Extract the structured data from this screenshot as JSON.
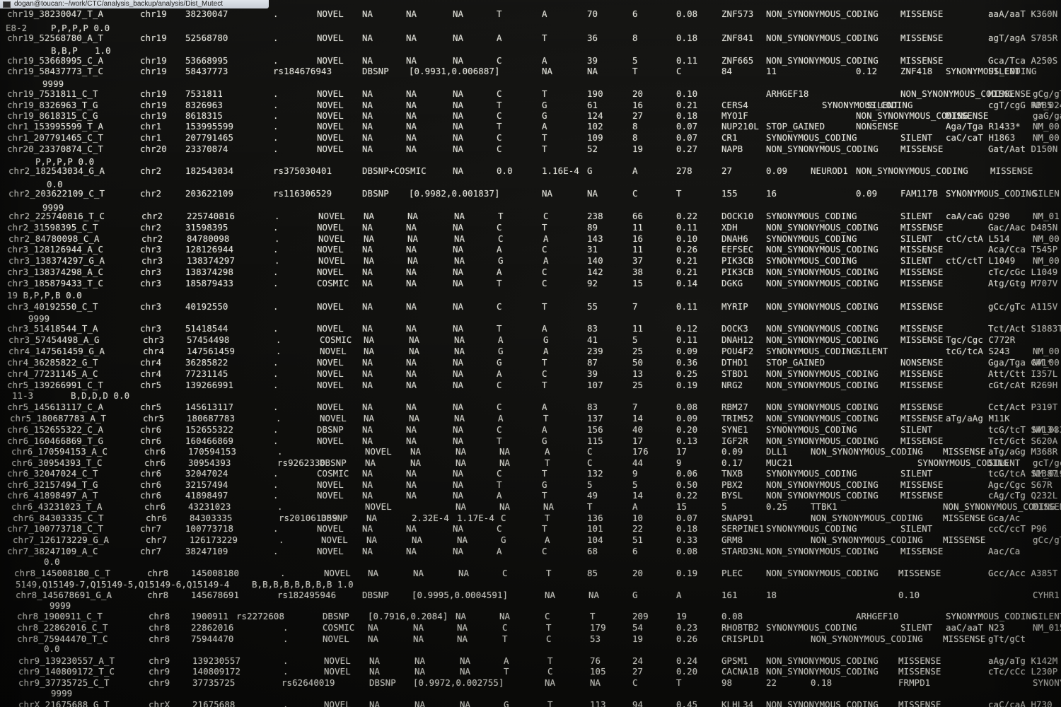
{
  "window": {
    "title": "dogan@toucan:~/work/CTC/analysis_backup/analysis/Dist_Mutect"
  },
  "rows": [
    [
      "chr19_38230047_T_A",
      "chr19",
      "38230047",
      ".",
      "NOVEL",
      "NA",
      "NA",
      "NA",
      "T",
      "A",
      "70",
      "6",
      "0.08",
      "ZNF573",
      "NON_SYNONYMOUS_CODING",
      "MISSENSE",
      "aaA/aaT K360N"
    ],
    [
      "E8-2",
      "P,P,P,P 0.0"
    ],
    [
      "chr19_52568780_A_T",
      "chr19",
      "52568780",
      ".",
      "NOVEL",
      "NA",
      "NA",
      "NA",
      "A",
      "T",
      "36",
      "8",
      "0.18",
      "ZNF841",
      "NON_SYNONYMOUS_CODING",
      "MISSENSE",
      "agT/agA S785R"
    ],
    [
      "B,B,P",
      "1.0"
    ],
    [
      "chr19_53668995_C_A",
      "chr19",
      "53668995",
      ".",
      "NOVEL",
      "NA",
      "NA",
      "NA",
      "C",
      "A",
      "39",
      "5",
      "0.11",
      "ZNF665",
      "NON_SYNONYMOUS_CODING",
      "MISSENSE",
      "Gca/Tca A250S"
    ],
    [
      "chr19_58437773_T_C",
      "chr19",
      "58437773",
      "rs184676943",
      "DBSNP",
      "[0.9931,0.006887]",
      "NA",
      "NA",
      "T",
      "C",
      "84",
      "11",
      "0.12",
      "ZNF418",
      "SYNONYMOUS_CODING",
      "SILENT"
    ],
    [
      "9999"
    ],
    [
      "chr19_7531811_C_T",
      "chr19",
      "7531811",
      ".",
      "NOVEL",
      "NA",
      "NA",
      "NA",
      "C",
      "T",
      "190",
      "20",
      "0.10",
      "ARHGEF18",
      "NON_SYNONYMOUS_CODING",
      "MISSENSE",
      "gCg/gTg A625V"
    ],
    [
      "chr19_8326963_T_G",
      "chr19",
      "8326963",
      ".",
      "NOVEL",
      "NA",
      "NA",
      "NA",
      "T",
      "G",
      "61",
      "16",
      "0.21",
      "CERS4",
      "SYNONYMOUS_CODING",
      "SILENT",
      "cgT/cgG R385",
      "NM_024552.2"
    ],
    [
      "chr19_8618315_C_G",
      "chr19",
      "8618315",
      ".",
      "NOVEL",
      "NA",
      "NA",
      "NA",
      "C",
      "G",
      "124",
      "27",
      "0.18",
      "MYO1F",
      "NON_SYNONYMOUS_CODING",
      "MISSENSE",
      "gaG/gaC E111D",
      "NM_01"
    ],
    [
      "chr1_153995599_T_A",
      "chr1",
      "153995599",
      ".",
      "NOVEL",
      "NA",
      "NA",
      "NA",
      "T",
      "A",
      "102",
      "8",
      "0.07",
      "NUP210L",
      "STOP_GAINED",
      "NONSENSE",
      "Aga/Tga R1433*",
      "NM_00"
    ],
    [
      "chr1_207791465_C_T",
      "chr1",
      "207791465",
      ".",
      "NOVEL",
      "NA",
      "NA",
      "NA",
      "C",
      "T",
      "109",
      "8",
      "0.07",
      "CR1",
      "SYNONYMOUS_CODING",
      "SILENT",
      "caC/caT H1863",
      "NM_00"
    ],
    [
      "chr20_23370874_C_T",
      "chr20",
      "23370874",
      ".",
      "NOVEL",
      "NA",
      "NA",
      "NA",
      "C",
      "T",
      "52",
      "19",
      "0.27",
      "NAPB",
      "NON_SYNONYMOUS_CODING",
      "MISSENSE",
      "Gat/Aat D150N"
    ],
    [
      "P,P,P,P 0.0"
    ],
    [
      "chr2_182543034_G_A",
      "chr2",
      "182543034",
      "rs375030401",
      "DBSNP+COSMIC",
      "NA",
      "0.0",
      "1.16E-4",
      "G",
      "A",
      "278",
      "27",
      "0.09",
      "NEUROD1",
      "NON_SYNONYMOUS_CODING",
      "MISSENSE"
    ],
    [
      "0.0"
    ],
    [
      "chr2_203622109_C_T",
      "chr2",
      "203622109",
      "rs116306529",
      "DBSNP",
      "[0.9982,0.001837]",
      "NA",
      "NA",
      "C",
      "T",
      "155",
      "16",
      "0.09",
      "FAM117B",
      "SYNONYMOUS_CODING",
      "SILEN"
    ],
    [
      "9999"
    ],
    [
      "chr2_225740816_T_C",
      "chr2",
      "225740816",
      ".",
      "NOVEL",
      "NA",
      "NA",
      "NA",
      "T",
      "C",
      "238",
      "66",
      "0.22",
      "DOCK10",
      "SYNONYMOUS_CODING",
      "SILENT",
      "caA/caG Q290",
      "NM_01"
    ],
    [
      "chr2_31598395_C_T",
      "chr2",
      "31598395",
      ".",
      "NOVEL",
      "NA",
      "NA",
      "NA",
      "C",
      "T",
      "89",
      "11",
      "0.11",
      "XDH",
      "NON_SYNONYMOUS_CODING",
      "MISSENSE",
      "Gac/Aac D485N"
    ],
    [
      "chr2_84780098_C_A",
      "chr2",
      "84780098",
      ".",
      "NOVEL",
      "NA",
      "NA",
      "NA",
      "C",
      "A",
      "143",
      "16",
      "0.10",
      "DNAH6",
      "SYNONYMOUS_CODING",
      "SILENT",
      "ctC/ctA L514",
      "NM_00"
    ],
    [
      "chr3_128126944_A_C",
      "chr3",
      "128126944",
      ".",
      "NOVEL",
      "NA",
      "NA",
      "NA",
      "A",
      "C",
      "31",
      "11",
      "0.26",
      "EEFSEC",
      "NON_SYNONYMOUS_CODING",
      "MISSENSE",
      "Aca/Cca T545P"
    ],
    [
      "chr3_138374297_G_A",
      "chr3",
      "138374297",
      ".",
      "NOVEL",
      "NA",
      "NA",
      "NA",
      "G",
      "A",
      "140",
      "37",
      "0.21",
      "PIK3CB",
      "SYNONYMOUS_CODING",
      "SILENT",
      "ctC/ctT L1049",
      "NM_00"
    ],
    [
      "chr3_138374298_A_C",
      "chr3",
      "138374298",
      ".",
      "NOVEL",
      "NA",
      "NA",
      "NA",
      "A",
      "C",
      "142",
      "38",
      "0.21",
      "PIK3CB",
      "NON_SYNONYMOUS_CODING",
      "MISSENSE",
      "cTc/cGc L1049"
    ],
    [
      "chr3_185879433_T_C",
      "chr3",
      "185879433",
      ".",
      "COSMIC",
      "NA",
      "NA",
      "NA",
      "T",
      "C",
      "92",
      "15",
      "0.14",
      "DGKG",
      "NON_SYNONYMOUS_CODING",
      "MISSENSE",
      "Atg/Gtg M707V"
    ],
    [
      "19 B,P,P,B 0.0"
    ],
    [
      "chr3_40192550_C_T",
      "chr3",
      "40192550",
      ".",
      "NOVEL",
      "NA",
      "NA",
      "NA",
      "C",
      "T",
      "55",
      "7",
      "0.11",
      "MYRIP",
      "NON_SYNONYMOUS_CODING",
      "MISSENSE",
      "gCc/gTc A115V"
    ],
    [
      "9999"
    ],
    [
      "chr3_51418544_T_A",
      "chr3",
      "51418544",
      ".",
      "NOVEL",
      "NA",
      "NA",
      "NA",
      "T",
      "A",
      "83",
      "11",
      "0.12",
      "DOCK3",
      "NON_SYNONYMOUS_CODING",
      "MISSENSE",
      "Tct/Act S1883T"
    ],
    [
      "chr3_57454498_A_G",
      "chr3",
      "57454498",
      ".",
      "COSMIC",
      "NA",
      "NA",
      "NA",
      "A",
      "G",
      "41",
      "5",
      "0.11",
      "DNAH12",
      "NON_SYNONYMOUS_CODING",
      "MISSENSE",
      "Tgc/Cgc C772R"
    ],
    [
      "chr4_147561459_G_A",
      "chr4",
      "147561459",
      ".",
      "NOVEL",
      "NA",
      "NA",
      "NA",
      "G",
      "A",
      "239",
      "25",
      "0.09",
      "POU4F2",
      "SYNONYMOUS_CODING",
      "SILENT",
      "tcG/tcA S243",
      "NM_00"
    ],
    [
      "chr4_36285822_G_T",
      "chr4",
      "36285822",
      ".",
      "NOVEL",
      "NA",
      "NA",
      "NA",
      "G",
      "T",
      "87",
      "50",
      "0.36",
      "DTHD1",
      "STOP_GAINED",
      "NONSENSE",
      "Gga/Tga G41*",
      "NM_00"
    ],
    [
      "chr4_77231145_A_C",
      "chr4",
      "77231145",
      ".",
      "NOVEL",
      "NA",
      "NA",
      "NA",
      "A",
      "C",
      "39",
      "13",
      "0.25",
      "STBD1",
      "NON_SYNONYMOUS_CODING",
      "MISSENSE",
      "Att/Ctt I357L"
    ],
    [
      "chr5_139266991_C_T",
      "chr5",
      "139266991",
      ".",
      "NOVEL",
      "NA",
      "NA",
      "NA",
      "C",
      "T",
      "107",
      "25",
      "0.19",
      "NRG2",
      "NON_SYNONYMOUS_CODING",
      "MISSENSE",
      "cGt/cAt R269H"
    ],
    [
      "11-3",
      "B,D,D,D 0.0"
    ],
    [
      "chr5_145613117_C_A",
      "chr5",
      "145613117",
      ".",
      "NOVEL",
      "NA",
      "NA",
      "NA",
      "C",
      "A",
      "83",
      "7",
      "0.08",
      "RBM27",
      "NON_SYNONYMOUS_CODING",
      "MISSENSE",
      "Cct/Act P319T"
    ],
    [
      "chr5_180687783_A_T",
      "chr5",
      "180687783",
      ".",
      "NOVEL",
      "NA",
      "NA",
      "NA",
      "A",
      "T",
      "137",
      "14",
      "0.09",
      "TRIM52",
      "NON_SYNONYMOUS_CODING",
      "MISSENSE",
      "aTg/aAg M11K"
    ],
    [
      "chr6_152655322_C_A",
      "chr6",
      "152655322",
      ".",
      "DBSNP",
      "NA",
      "NA",
      "NA",
      "C",
      "A",
      "156",
      "40",
      "0.20",
      "SYNE1",
      "SYNONYMOUS_CODING",
      "SILENT",
      "tcG/tcT S4134",
      "NM_033"
    ],
    [
      "chr6_160466869_T_G",
      "chr6",
      "160466869",
      ".",
      "NOVEL",
      "NA",
      "NA",
      "NA",
      "T",
      "G",
      "115",
      "17",
      "0.13",
      "IGF2R",
      "NON_SYNONYMOUS_CODING",
      "MISSENSE",
      "Tct/Gct S620A"
    ],
    [
      "chr6_170594153_A_C",
      "chr6",
      "170594153",
      ".",
      "NOVEL",
      "NA",
      "NA",
      "NA",
      "A",
      "C",
      "176",
      "17",
      "0.09",
      "DLL1",
      "NON_SYNONYMOUS_CODING",
      "MISSENSE",
      "aTg/aGg M368R"
    ],
    [
      "chr6_30954393_T_C",
      "chr6",
      "30954393",
      "rs9262330",
      "DBSNP",
      "NA",
      "NA",
      "NA",
      "NA",
      "T",
      "C",
      "44",
      "9",
      "0.17",
      "MUC21",
      "SYNONYMOUS_CODING",
      "SILENT",
      "gcT/gcC A147"
    ],
    [
      "chr6_32047024_C_T",
      "chr6",
      "32047024",
      ".",
      "COSMIC",
      "NA",
      "NA",
      "NA",
      "C",
      "T",
      "132",
      "9",
      "0.06",
      "TNXB",
      "SYNONYMOUS_CODING",
      "SILENT",
      "tcG/tcA S1387",
      "NM_019"
    ],
    [
      "chr6_32157494_T_G",
      "chr6",
      "32157494",
      ".",
      "NOVEL",
      "NA",
      "NA",
      "NA",
      "T",
      "G",
      "5",
      "5",
      "0.50",
      "PBX2",
      "NON_SYNONYMOUS_CODING",
      "MISSENSE",
      "Agc/Cgc S67R"
    ],
    [
      "chr6_41898497_A_T",
      "chr6",
      "41898497",
      ".",
      "NOVEL",
      "NA",
      "NA",
      "NA",
      "A",
      "T",
      "49",
      "14",
      "0.22",
      "BYSL",
      "NON_SYNONYMOUS_CODING",
      "MISSENSE",
      "cAg/cTg Q232L"
    ],
    [
      "chr6_43231023_T_A",
      "chr6",
      "43231023",
      ".",
      "NOVEL",
      "NA",
      "NA",
      "NA",
      "T",
      "A",
      "15",
      "5",
      "0.25",
      "TTBK1",
      "NON_SYNONYMOUS_CODING",
      "MISSENSE",
      "Tca/Aca S641T"
    ],
    [
      "chr6_84303335_C_T",
      "chr6",
      "84303335",
      "rs201061359",
      "DBSNP",
      "NA",
      "2.32E-4",
      "1.17E-4",
      "C",
      "T",
      "136",
      "10",
      "0.07",
      "SNAP91",
      "NON_SYNONYMOUS_CODING",
      "MISSENSE",
      "Gca/Ac"
    ],
    [
      "chr7_100773718_C_T",
      "chr7",
      "100773718",
      ".",
      "NOVEL",
      "NA",
      "NA",
      "NA",
      "C",
      "T",
      "101",
      "22",
      "0.18",
      "SERPINE1",
      "SYNONYMOUS_CODING",
      "SILENT",
      "ccC/ccT P96"
    ],
    [
      "chr7_126173229_G_A",
      "chr7",
      "126173229",
      ".",
      "NOVEL",
      "NA",
      "NA",
      "NA",
      "G",
      "A",
      "104",
      "51",
      "0.33",
      "GRM8",
      "NON_SYNONYMOUS_CODING",
      "MISSENSE",
      "gCc/gTc A736V"
    ],
    [
      "chr7_38247109_A_C",
      "chr7",
      "38247109",
      ".",
      "NOVEL",
      "NA",
      "NA",
      "NA",
      "A",
      "C",
      "68",
      "6",
      "0.08",
      "STARD3NL",
      "NON_SYNONYMOUS_CODING",
      "MISSENSE",
      "Aac/Ca"
    ],
    [
      "0.0"
    ],
    [
      "chr8_145008180_C_T",
      "chr8",
      "145008180",
      ".",
      "NOVEL",
      "NA",
      "NA",
      "NA",
      "C",
      "T",
      "85",
      "20",
      "0.19",
      "PLEC",
      "NON_SYNONYMOUS_CODING",
      "MISSENSE",
      "Gcc/Acc A385T"
    ],
    [
      "5149,Q15149-7,Q15149-5,Q15149-6,Q15149-4",
      "B,B,B,B,B,B,B,B 1.0"
    ],
    [
      "chr8_145678691_G_A",
      "chr8",
      "145678691",
      "rs182495946",
      "DBSNP",
      "[0.9995,0.0004591]",
      "NA",
      "NA",
      "G",
      "A",
      "161",
      "18",
      "0.10",
      "CYHR1",
      "SYNONYMOUS_CODING",
      "SILENT"
    ],
    [
      "9999"
    ],
    [
      "chr8_1900911_C_T",
      "chr8",
      "1900911",
      "rs2272608",
      "DBSNP",
      "[0.7916,0.2084]",
      "NA",
      "NA",
      "C",
      "T",
      "209",
      "19",
      "0.08",
      "ARHGEF10",
      "SYNONYMOUS_CODING",
      "SILENT",
      "caC/ca"
    ],
    [
      "chr8_22862016_C_T",
      "chr8",
      "22862016",
      ".",
      "COSMIC",
      "NA",
      "NA",
      "NA",
      "C",
      "T",
      "179",
      "54",
      "0.23",
      "RHOBTB2",
      "SYNONYMOUS_CODING",
      "SILENT",
      "aaC/aaT N23",
      "NM_015"
    ],
    [
      "chr8_75944470_T_C",
      "chr8",
      "75944470",
      ".",
      "NOVEL",
      "NA",
      "NA",
      "NA",
      "T",
      "C",
      "53",
      "19",
      "0.26",
      "CRISPLD1",
      "NON_SYNONYMOUS_CODING",
      "MISSENSE",
      "gTt/gCt"
    ],
    [
      "0.0"
    ],
    [
      "chr9_139230557_A_T",
      "chr9",
      "139230557",
      ".",
      "NOVEL",
      "NA",
      "NA",
      "NA",
      "A",
      "T",
      "76",
      "24",
      "0.24",
      "GPSM1",
      "NON_SYNONYMOUS_CODING",
      "MISSENSE",
      "aAg/aTg K142M"
    ],
    [
      "chr9_140809172_T_C",
      "chr9",
      "140809172",
      ".",
      "NOVEL",
      "NA",
      "NA",
      "NA",
      "T",
      "C",
      "105",
      "27",
      "0.20",
      "CACNA1B",
      "NON_SYNONYMOUS_CODING",
      "MISSENSE",
      "cTc/cCc L230P"
    ],
    [
      "chr9_37735725_C_T",
      "chr9",
      "37735725",
      "rs62640019",
      "DBSNP",
      "[0.9972,0.002755]",
      "NA",
      "NA",
      "C",
      "T",
      "98",
      "22",
      "0.18",
      "FRMPD1",
      "SYNONYMOUS_CODING",
      "SILENT"
    ],
    [
      "9999"
    ],
    [
      "chrX_21675688_G_T",
      "chrX",
      "21675688",
      ".",
      "NOVEL",
      "NA",
      "NA",
      "NA",
      "G",
      "T",
      "113",
      "94",
      "0.45",
      "KLHL34",
      "NON_SYNONYMOUS_CODING",
      "MISSENSE",
      "caC/caA H730"
    ]
  ]
}
